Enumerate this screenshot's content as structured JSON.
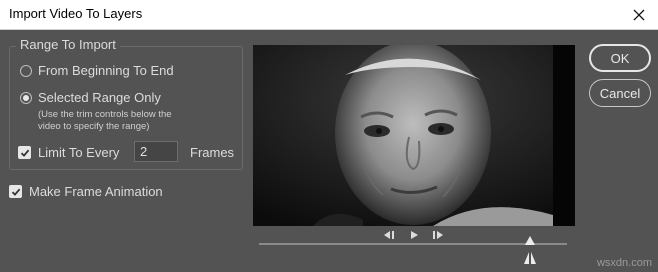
{
  "window": {
    "title": "Import Video To Layers",
    "close_icon": "close-icon"
  },
  "range_group": {
    "legend": "Range To Import",
    "option_all": "From Beginning To End",
    "option_selected": "Selected Range Only",
    "selected": "selected",
    "note_line1": "(Use the trim controls below the",
    "note_line2": "video to specify the range)"
  },
  "limit": {
    "label": "Limit To Every",
    "checked": true,
    "value": "2",
    "unit": "Frames"
  },
  "frame_animation": {
    "label": "Make Frame Animation",
    "checked": true
  },
  "buttons": {
    "ok": "OK",
    "cancel": "Cancel"
  },
  "preview": {
    "scrub_position": 0.88
  },
  "watermark": "wsxdn.com",
  "colors": {
    "bg": "#535353",
    "text": "#dcdcdc",
    "titlebar": "#ffffff"
  }
}
